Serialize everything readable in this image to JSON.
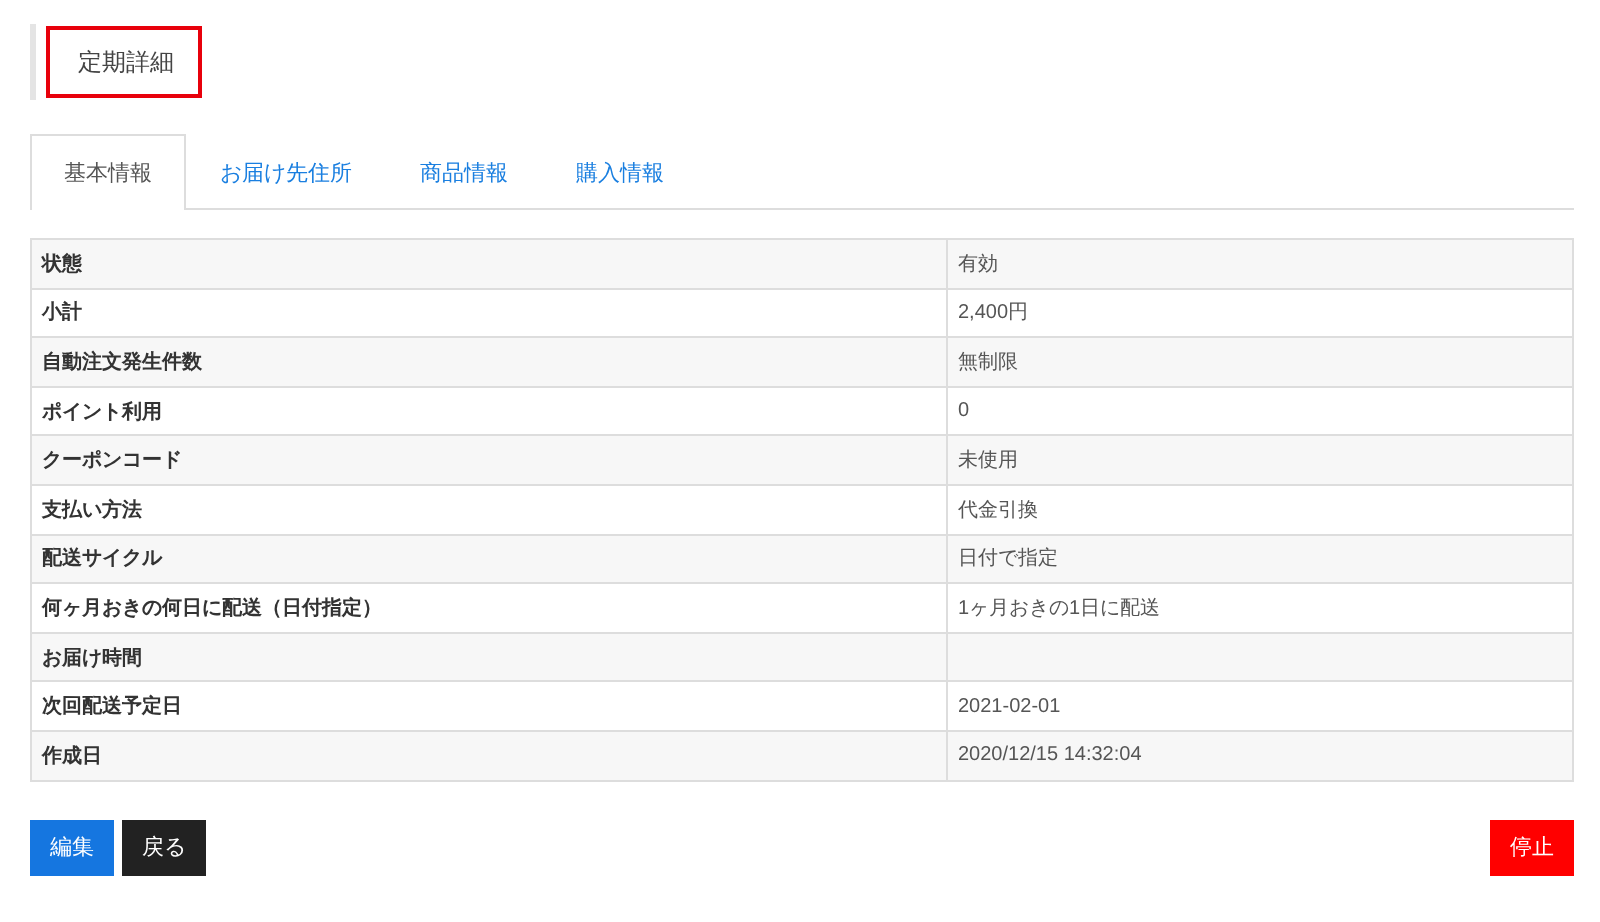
{
  "page_title": "定期詳細",
  "tabs": [
    {
      "label": "基本情報",
      "selected": true
    },
    {
      "label": "お届け先住所",
      "selected": false
    },
    {
      "label": "商品情報",
      "selected": false
    },
    {
      "label": "購入情報",
      "selected": false
    }
  ],
  "table": {
    "rows": [
      {
        "label": "状態",
        "value": "有効"
      },
      {
        "label": "小計",
        "value": "2,400円"
      },
      {
        "label": "自動注文発生件数",
        "value": "無制限"
      },
      {
        "label": "ポイント利用",
        "value": "0"
      },
      {
        "label": "クーポンコード",
        "value": "未使用"
      },
      {
        "label": "支払い方法",
        "value": "代金引換"
      },
      {
        "label": "配送サイクル",
        "value": "日付で指定"
      },
      {
        "label": "何ヶ月おきの何日に配送（日付指定）",
        "value": "1ヶ月おきの1日に配送"
      },
      {
        "label": "お届け時間"
      },
      {
        "label": "次回配送予定日",
        "value": "2021-02-01"
      },
      {
        "label": "作成日",
        "value": "2020/12/15 14:32:04"
      }
    ]
  },
  "buttons": [
    {
      "label": "編集",
      "kind": "primary"
    },
    {
      "label": "戻る",
      "kind": "dark"
    },
    {
      "label": "停止",
      "kind": "danger"
    }
  ]
}
